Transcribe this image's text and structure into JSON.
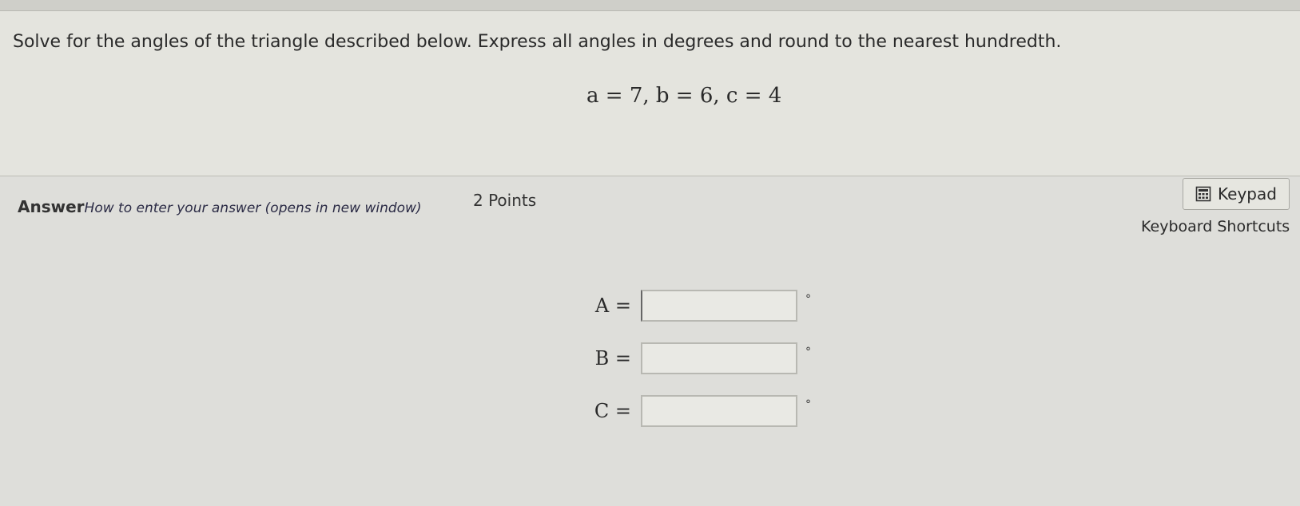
{
  "question": {
    "prompt": "Solve for the angles of the triangle described below. Express all angles in degrees and round to the nearest hundredth.",
    "equation": "a = 7, b = 6, c = 4"
  },
  "answer": {
    "label": "Answer",
    "help_link": "How to enter your answer (opens in new window)",
    "points": "2 Points",
    "keypad_label": "Keypad",
    "keypad_icon": "calculator-icon",
    "shortcuts_label": "Keyboard Shortcuts"
  },
  "fields": [
    {
      "label": "A =",
      "value": "",
      "unit": "°"
    },
    {
      "label": "B =",
      "value": "",
      "unit": "°"
    },
    {
      "label": "C =",
      "value": "",
      "unit": "°"
    }
  ]
}
